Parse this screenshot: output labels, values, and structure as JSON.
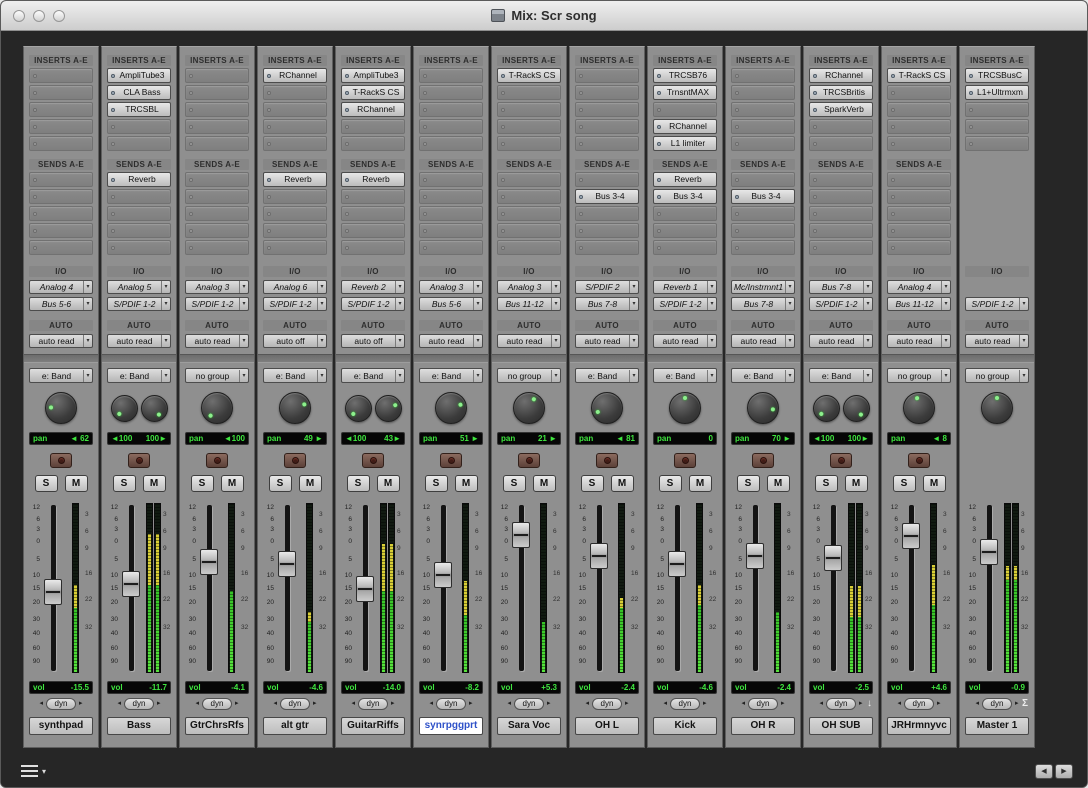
{
  "window": {
    "title": "Mix: Scr song"
  },
  "section_labels": {
    "inserts": "INSERTS A-E",
    "sends": "SENDS A-E",
    "io": "I/O",
    "auto": "AUTO"
  },
  "buttons": {
    "solo": "S",
    "mute": "M",
    "dyn": "dyn",
    "nudge_left": "◂",
    "nudge_right": "▸",
    "selector_arrow": "▾",
    "scroll_left": "◀",
    "scroll_right": "▶"
  },
  "scales": {
    "fader": [
      "12",
      "6",
      "3",
      "0",
      "5",
      "10",
      "15",
      "20",
      "30",
      "40",
      "60",
      "90"
    ],
    "meter": [
      "3",
      "6",
      "9",
      "16",
      "22",
      "32"
    ]
  },
  "colors": {
    "meter_green": "#4ad62c",
    "meter_yellow": "#d9cf36",
    "display_green": "#3fe63f",
    "selected_name_text": "#2e51c8",
    "strip_gray": "#8f8f8f"
  },
  "channels": [
    {
      "name": "synthpad",
      "selected": false,
      "is_master": false,
      "inserts": [
        "",
        "",
        "",
        "",
        ""
      ],
      "sends": [
        "",
        "",
        "",
        "",
        ""
      ],
      "input": "Analog 4",
      "output": "Bus 5-6",
      "auto_mode": "auto read",
      "group": "e: Band",
      "knob_angles": [
        -87
      ],
      "pan": [
        "pan",
        "◄ 62"
      ],
      "vol": [
        "vol",
        "-15.5"
      ],
      "dyn_extra": "",
      "fader_pct": 53,
      "meter_bars": 1,
      "meter_green": 38,
      "meter_yellow": 14
    },
    {
      "name": "Bass",
      "selected": false,
      "is_master": false,
      "inserts": [
        "AmpliTube3",
        "CLA Bass",
        "TRCSBL",
        "",
        ""
      ],
      "sends": [
        "Reverb",
        "",
        "",
        "",
        ""
      ],
      "input": "Analog 5",
      "output": "S/PDIF 1-2",
      "auto_mode": "auto read",
      "group": "e: Band",
      "knob_angles": [
        -140,
        140
      ],
      "pan": [
        "◄100",
        "100►"
      ],
      "vol": [
        "vol",
        "-11.7"
      ],
      "dyn_extra": "",
      "fader_pct": 47,
      "meter_bars": 2,
      "meter_green": 52,
      "meter_yellow": 30
    },
    {
      "name": "GtrChrsRfs",
      "selected": false,
      "is_master": false,
      "inserts": [
        "",
        "",
        "",
        "",
        ""
      ],
      "sends": [
        "",
        "",
        "",
        "",
        ""
      ],
      "input": "Analog 3",
      "output": "S/PDIF 1-2",
      "auto_mode": "auto read",
      "group": "no group",
      "knob_angles": [
        -140
      ],
      "pan": [
        "pan",
        "◄100"
      ],
      "vol": [
        "vol",
        "-4.1"
      ],
      "dyn_extra": "",
      "fader_pct": 32,
      "meter_bars": 1,
      "meter_green": 48,
      "meter_yellow": 0
    },
    {
      "name": "alt gtr",
      "selected": false,
      "is_master": false,
      "inserts": [
        "RChannel",
        "",
        "",
        "",
        ""
      ],
      "sends": [
        "Reverb",
        "",
        "",
        "",
        ""
      ],
      "input": "Analog 6",
      "output": "S/PDIF 1-2",
      "auto_mode": "auto off",
      "group": "e: Band",
      "knob_angles": [
        69
      ],
      "pan": [
        "pan",
        "49 ►"
      ],
      "vol": [
        "vol",
        "-4.6"
      ],
      "dyn_extra": "",
      "fader_pct": 33,
      "meter_bars": 1,
      "meter_green": 30,
      "meter_yellow": 6
    },
    {
      "name": "GuitarRiffs",
      "selected": false,
      "is_master": false,
      "inserts": [
        "AmpliTube3",
        "T-RackS CS",
        "RChannel",
        "",
        ""
      ],
      "sends": [
        "Reverb",
        "",
        "",
        "",
        ""
      ],
      "input": "Reverb 2",
      "output": "S/PDIF 1-2",
      "auto_mode": "auto off",
      "group": "e: Band",
      "knob_angles": [
        -140,
        60
      ],
      "pan": [
        "◄100",
        "43►"
      ],
      "vol": [
        "vol",
        "-14.0"
      ],
      "dyn_extra": "",
      "fader_pct": 51,
      "meter_bars": 2,
      "meter_green": 48,
      "meter_yellow": 28
    },
    {
      "name": "synrpggprt",
      "selected": true,
      "is_master": false,
      "inserts": [
        "",
        "",
        "",
        "",
        ""
      ],
      "sends": [
        "",
        "",
        "",
        "",
        ""
      ],
      "input": "Analog 3",
      "output": "Bus 5-6",
      "auto_mode": "auto read",
      "group": "e: Band",
      "knob_angles": [
        71
      ],
      "pan": [
        "pan",
        "51 ►"
      ],
      "vol": [
        "vol",
        "-8.2"
      ],
      "dyn_extra": "",
      "fader_pct": 41,
      "meter_bars": 1,
      "meter_green": 34,
      "meter_yellow": 20
    },
    {
      "name": "Sara Voc",
      "selected": false,
      "is_master": false,
      "inserts": [
        "T-RackS CS",
        "",
        "",
        "",
        ""
      ],
      "sends": [
        "",
        "",
        "",
        "",
        ""
      ],
      "input": "Analog 3",
      "output": "Bus 11-12",
      "auto_mode": "auto read",
      "group": "no group",
      "knob_angles": [
        29
      ],
      "pan": [
        "pan",
        "21 ►"
      ],
      "vol": [
        "vol",
        "+5.3"
      ],
      "dyn_extra": "",
      "fader_pct": 13,
      "meter_bars": 1,
      "meter_green": 30,
      "meter_yellow": 0
    },
    {
      "name": "OH L",
      "selected": false,
      "is_master": false,
      "inserts": [
        "",
        "",
        "",
        "",
        ""
      ],
      "sends": [
        "",
        "Bus 3-4",
        "",
        "",
        ""
      ],
      "input": "S/PDIF 2",
      "output": "Bus 7-8",
      "auto_mode": "auto read",
      "group": "e: Band",
      "knob_angles": [
        -113
      ],
      "pan": [
        "pan",
        "◄ 81"
      ],
      "vol": [
        "vol",
        "-2.4"
      ],
      "dyn_extra": "",
      "fader_pct": 28,
      "meter_bars": 1,
      "meter_green": 38,
      "meter_yellow": 6
    },
    {
      "name": "Kick",
      "selected": false,
      "is_master": false,
      "inserts": [
        "TRCSB76",
        "TrnsntMAX",
        "",
        "RChannel",
        "L1 limiter"
      ],
      "sends": [
        "Reverb",
        "Bus 3-4",
        "",
        "",
        ""
      ],
      "input": "Reverb 1",
      "output": "S/PDIF 1-2",
      "auto_mode": "auto read",
      "group": "e: Band",
      "knob_angles": [
        0
      ],
      "pan": [
        "pan",
        "0"
      ],
      "vol": [
        "vol",
        "-4.6"
      ],
      "dyn_extra": "",
      "fader_pct": 33,
      "meter_bars": 1,
      "meter_green": 40,
      "meter_yellow": 12
    },
    {
      "name": "OH R",
      "selected": false,
      "is_master": false,
      "inserts": [
        "",
        "",
        "",
        "",
        ""
      ],
      "sends": [
        "",
        "Bus 3-4",
        "",
        "",
        ""
      ],
      "input": "Mc/Instrmnt1",
      "output": "Bus 7-8",
      "auto_mode": "auto read",
      "group": "e: Band",
      "knob_angles": [
        98
      ],
      "pan": [
        "pan",
        "70 ►"
      ],
      "vol": [
        "vol",
        "-2.4"
      ],
      "dyn_extra": "",
      "fader_pct": 28,
      "meter_bars": 1,
      "meter_green": 36,
      "meter_yellow": 0
    },
    {
      "name": "OH SUB",
      "selected": false,
      "is_master": false,
      "inserts": [
        "RChannel",
        "TRCSBritis",
        "SparkVerb",
        "",
        ""
      ],
      "sends": [
        "",
        "",
        "",
        "",
        ""
      ],
      "input": "Bus 7-8",
      "output": "S/PDIF 1-2",
      "auto_mode": "auto read",
      "group": "e: Band",
      "knob_angles": [
        -140,
        140
      ],
      "pan": [
        "◄100",
        "100►"
      ],
      "vol": [
        "vol",
        "-2.5"
      ],
      "dyn_extra": "↓",
      "fader_pct": 29,
      "meter_bars": 2,
      "meter_green": 33,
      "meter_yellow": 18
    },
    {
      "name": "JRHrmnyvc",
      "selected": false,
      "is_master": false,
      "inserts": [
        "T-RackS CS",
        "",
        "",
        "",
        ""
      ],
      "sends": [
        "",
        "",
        "",
        "",
        ""
      ],
      "input": "Analog 4",
      "output": "Bus 11-12",
      "auto_mode": "auto read",
      "group": "no group",
      "knob_angles": [
        -11
      ],
      "pan": [
        "pan",
        "◄ 8"
      ],
      "vol": [
        "vol",
        "+4.6"
      ],
      "dyn_extra": "",
      "fader_pct": 14,
      "meter_bars": 1,
      "meter_green": 40,
      "meter_yellow": 24
    },
    {
      "name": "Master 1",
      "selected": false,
      "is_master": true,
      "inserts": [
        "TRCSBusC",
        "L1+Ultrmxm",
        "",
        "",
        ""
      ],
      "sends": null,
      "input": "",
      "output": "S/PDIF 1-2",
      "auto_mode": "auto read",
      "group": "no group",
      "knob_angles": [
        0
      ],
      "pan": null,
      "vol": [
        "vol",
        "-0.9"
      ],
      "dyn_extra": "Σ",
      "fader_pct": 25,
      "meter_bars": 2,
      "meter_green": 55,
      "meter_yellow": 8
    }
  ]
}
